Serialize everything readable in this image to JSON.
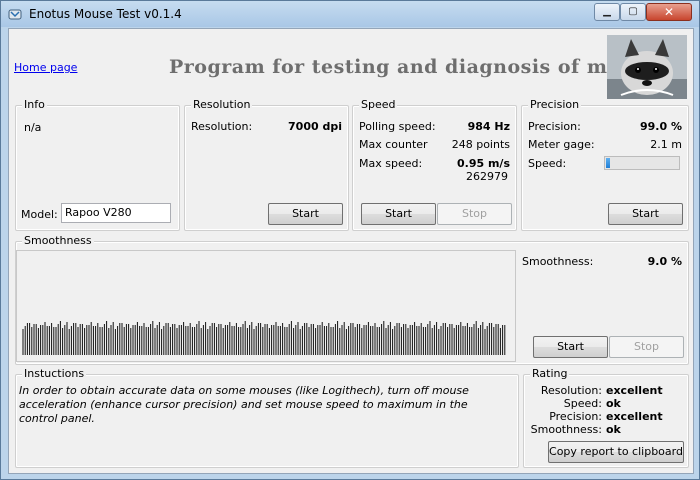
{
  "window": {
    "title": "Enotus Mouse Test v0.1.4"
  },
  "header": {
    "home_link": "Home page",
    "banner": "Program for testing and diagnosis of mice"
  },
  "info": {
    "title": "Info",
    "text": "n/a",
    "model_label": "Model:",
    "model_value": "Rapoo V280"
  },
  "resolution": {
    "title": "Resolution",
    "label": "Resolution:",
    "value": "7000 dpi",
    "start": "Start"
  },
  "speed": {
    "title": "Speed",
    "polling_label": "Polling speed:",
    "polling_value": "984 Hz",
    "max_counter_label": "Max counter",
    "max_counter_value": "248 points",
    "max_speed_label": "Max  speed:",
    "max_speed_value": "0.95 m/s",
    "max_speed_sub": "262979",
    "start": "Start",
    "stop": "Stop"
  },
  "precision": {
    "title": "Precision",
    "precision_label": "Precision:",
    "precision_value": "99.0 %",
    "meter_label": "Meter gage:",
    "meter_value": "2.1 m",
    "speed_label": "Speed:",
    "speed_level": 0.06,
    "start": "Start"
  },
  "smoothness": {
    "title": "Smoothness",
    "label": "Smoothness:",
    "value": "9.0 %",
    "start": "Start",
    "stop": "Stop",
    "bar_count": 220
  },
  "instructions": {
    "title": "Instuctions",
    "text": "In order to obtain accurate data on some mouses (like Logithech), turn off mouse acceleration (enhance cursor precision) and set mouse speed to maximum in the control panel."
  },
  "rating": {
    "title": "Rating",
    "rows": [
      {
        "label": "Resolution:",
        "value": "excellent"
      },
      {
        "label": "Speed:",
        "value": "ok"
      },
      {
        "label": "Precision:",
        "value": "excellent"
      },
      {
        "label": "Smoothness:",
        "value": "ok"
      }
    ],
    "copy_button": "Copy report to clipboard"
  },
  "colors": {
    "accent": "#1f7fd6",
    "link": "#0000ee",
    "banner": "#6e6e6e"
  },
  "icons": {
    "app": "mouse-app-icon",
    "photo": "raccoon-photo"
  }
}
